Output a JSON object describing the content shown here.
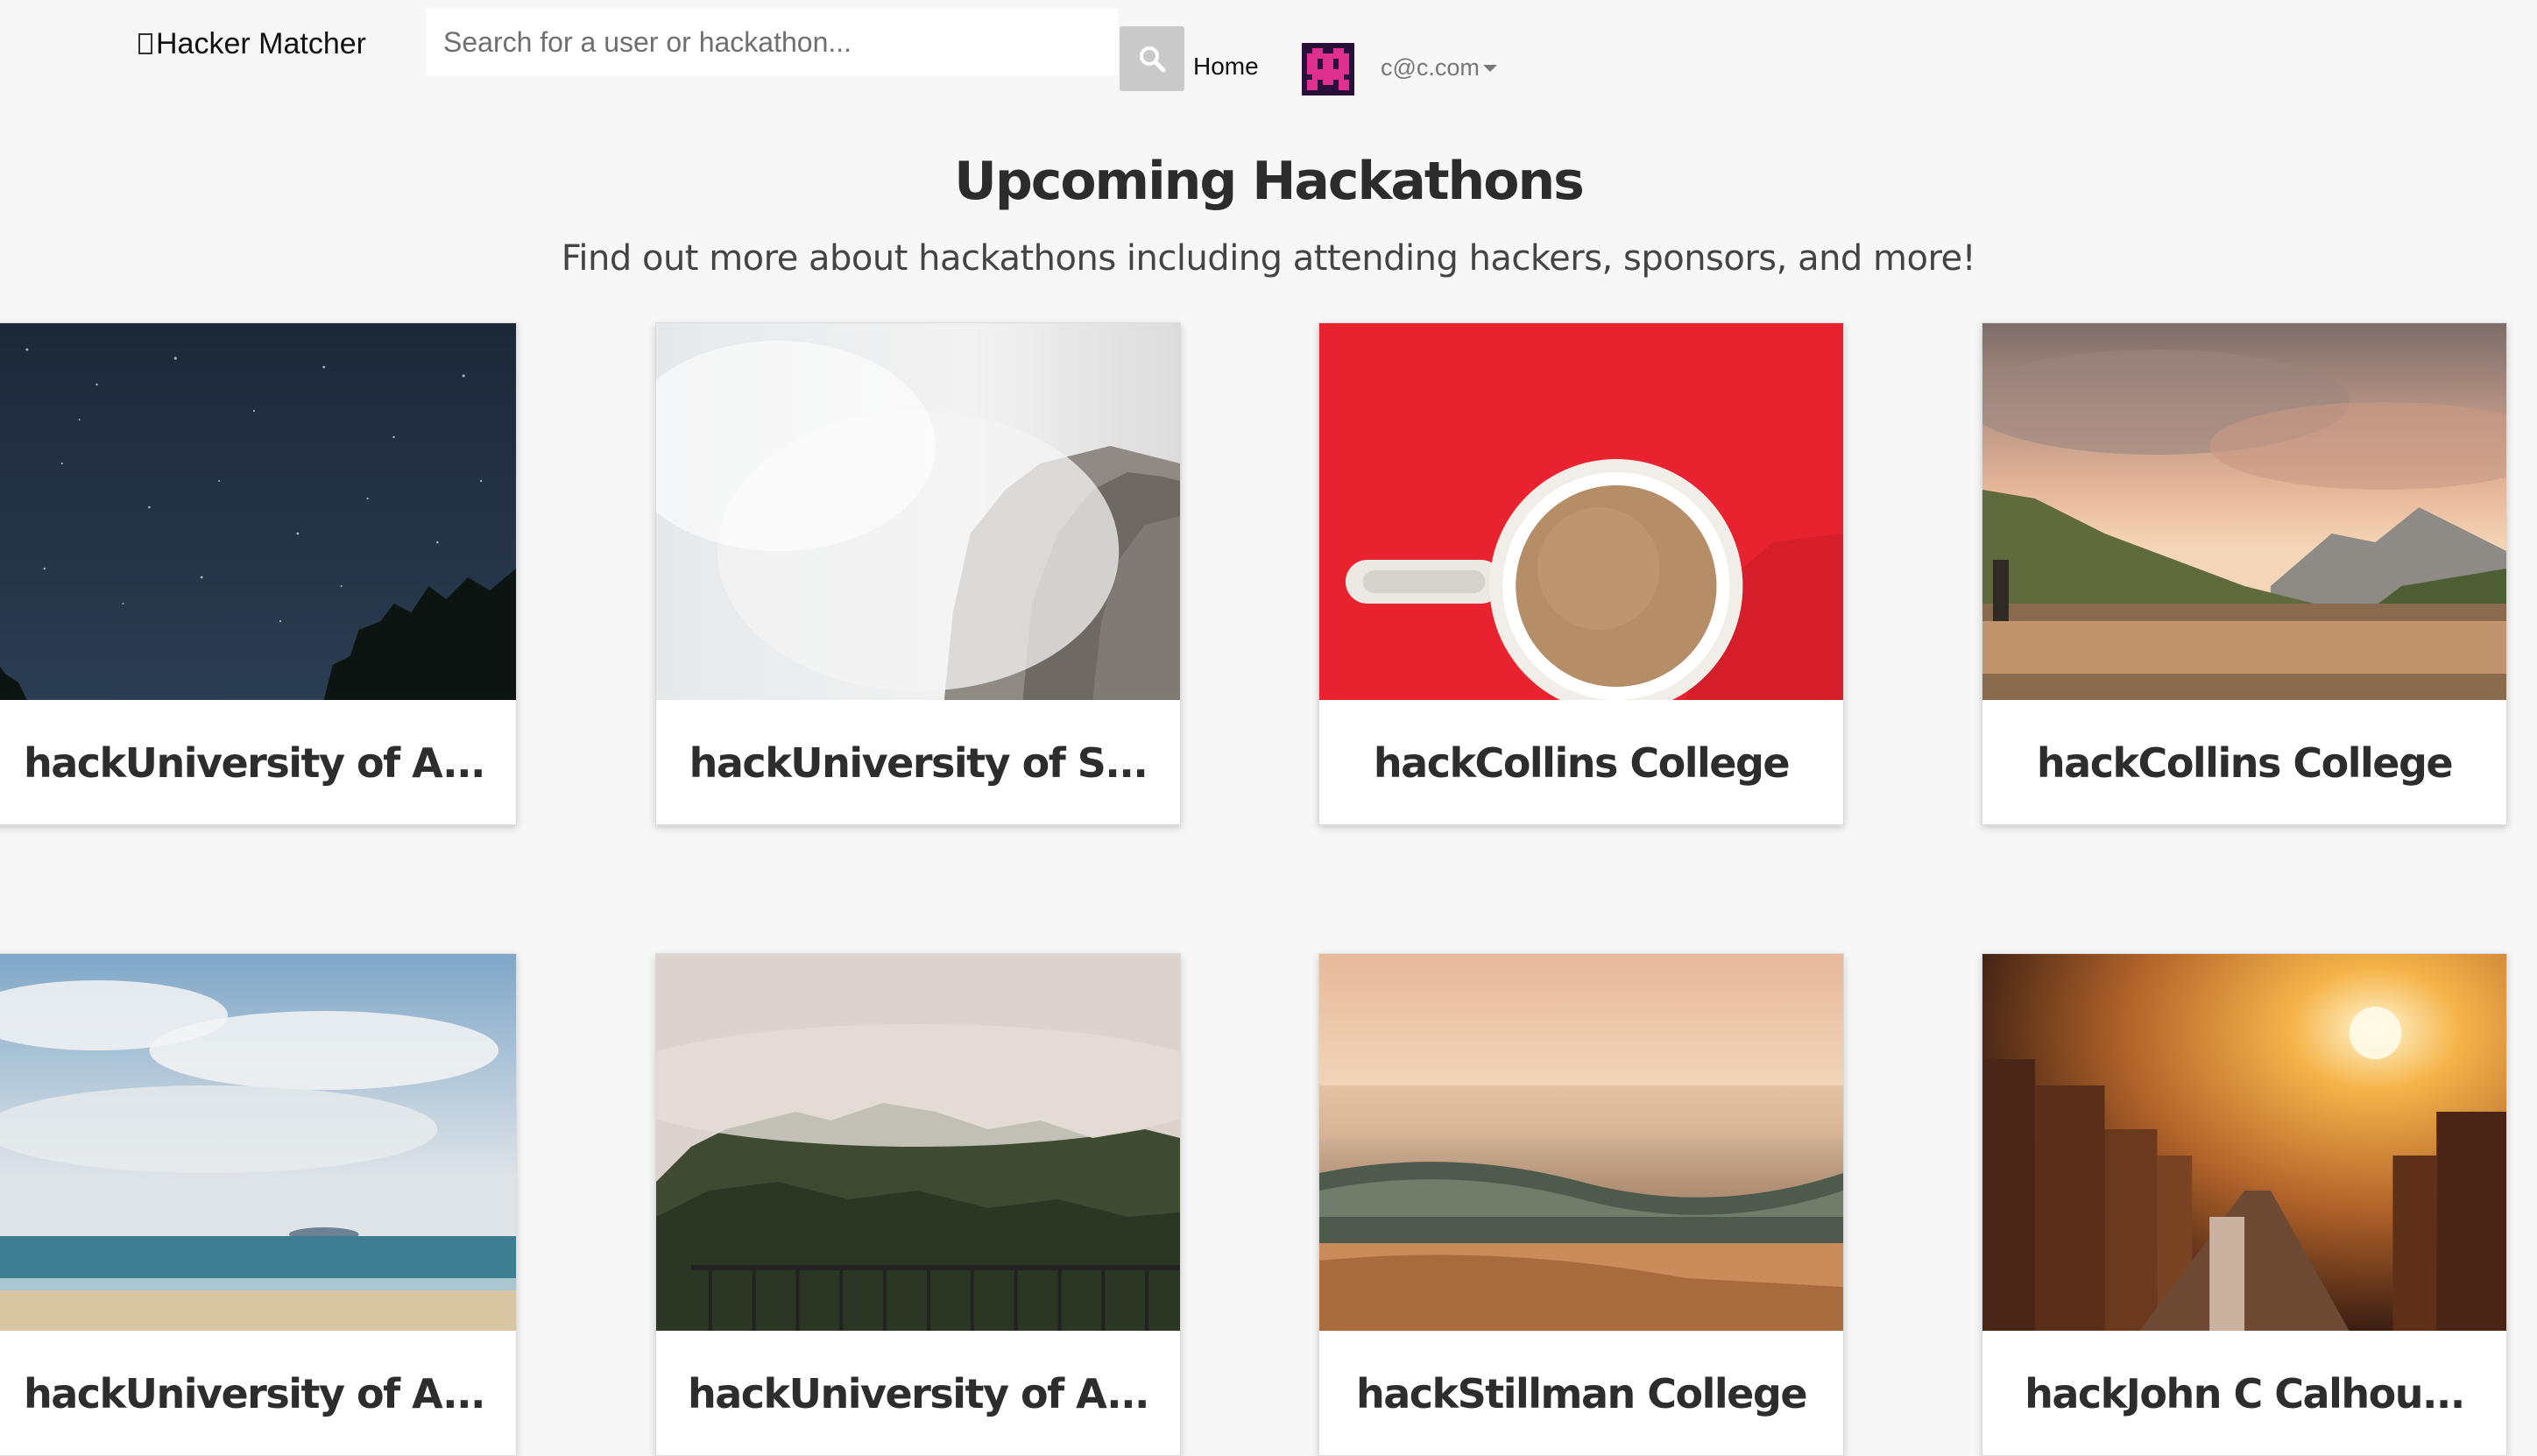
{
  "navbar": {
    "brand": "Hacker Matcher",
    "brand_icon": "broken-glyph-icon",
    "search": {
      "placeholder": "Search for a user or hackathon...",
      "value": "",
      "button_icon": "search-icon"
    },
    "home_link": "Home",
    "user": {
      "avatar_icon": "pixel-avatar-icon",
      "email": "c@c.com",
      "menu_icon": "caret-down-icon"
    }
  },
  "header": {
    "title": "Upcoming Hackathons",
    "subtitle": "Find out more about hackathons including attending hackers, sponsors, and more!"
  },
  "hackathons": [
    {
      "title": "hackUniversity of A...",
      "image": "starry-night-sky"
    },
    {
      "title": "hackUniversity of S...",
      "image": "misty-cliff"
    },
    {
      "title": "hackCollins College",
      "image": "coffee-cup-on-red"
    },
    {
      "title": "hackCollins College",
      "image": "mountain-lake-sunset"
    },
    {
      "title": "hackUniversity of A...",
      "image": "beach-cloudy-sky"
    },
    {
      "title": "hackUniversity of A...",
      "image": "foggy-forest-railing"
    },
    {
      "title": "hackStillman College",
      "image": "ocean-waves-sunset"
    },
    {
      "title": "hackJohn C Calhou...",
      "image": "city-street-sunset"
    }
  ],
  "colors": {
    "page_background": "#f6f7f6",
    "card_background": "#ffffff",
    "search_button": "#c9c9c9",
    "avatar": "#e0308f"
  }
}
